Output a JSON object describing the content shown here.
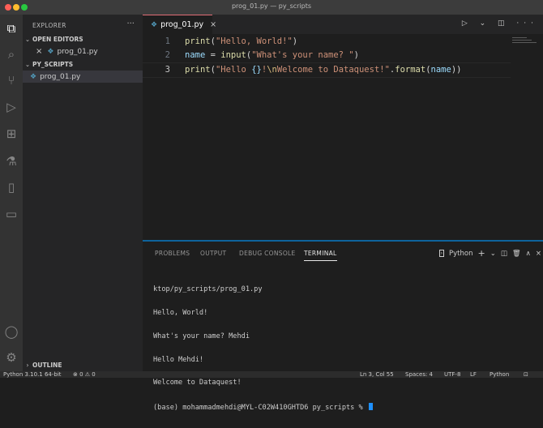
{
  "window": {
    "title": "prog_01.py — py_scripts"
  },
  "traffic_lights": [
    "#ff5f57",
    "#febc2e",
    "#28c840"
  ],
  "activity_bar": {
    "items": [
      "explorer-icon",
      "search-icon",
      "source-control-icon",
      "run-debug-icon",
      "extensions-icon",
      "flask-icon",
      "book-icon",
      "remote-explorer-icon",
      "account-icon",
      "gear-icon"
    ]
  },
  "sidebar": {
    "title": "EXPLORER",
    "more": "···",
    "open_editors": {
      "label": "OPEN EDITORS",
      "close": "×",
      "file": "prog_01.py"
    },
    "folder": {
      "label": "PY_SCRIPTS",
      "file": "prog_01.py"
    },
    "outline": "OUTLINE"
  },
  "tab": {
    "label": "prog_01.py",
    "close": "×"
  },
  "tab_actions": "▷ ⌄ ◫ ···",
  "editor": {
    "lines": [
      {
        "num": "1",
        "tokens": [
          {
            "t": "print",
            "c": "fn"
          },
          {
            "t": "(",
            "c": "op"
          },
          {
            "t": "\"Hello, World!\"",
            "c": "str"
          },
          {
            "t": ")",
            "c": "op"
          }
        ]
      },
      {
        "num": "2",
        "tokens": [
          {
            "t": "name",
            "c": "var"
          },
          {
            "t": " = ",
            "c": "op"
          },
          {
            "t": "input",
            "c": "fn"
          },
          {
            "t": "(",
            "c": "op"
          },
          {
            "t": "\"What's your name? \"",
            "c": "str"
          },
          {
            "t": ")",
            "c": "op"
          }
        ]
      },
      {
        "num": "3",
        "tokens": [
          {
            "t": "print",
            "c": "fn"
          },
          {
            "t": "(",
            "c": "op"
          },
          {
            "t": "\"Hello ",
            "c": "str"
          },
          {
            "t": "{}",
            "c": "var"
          },
          {
            "t": "!",
            "c": "str"
          },
          {
            "t": "\\n",
            "c": "esc"
          },
          {
            "t": "Welcome to Dataquest!\"",
            "c": "str"
          },
          {
            "t": ".",
            "c": "op"
          },
          {
            "t": "format",
            "c": "fn"
          },
          {
            "t": "(",
            "c": "op"
          },
          {
            "t": "name",
            "c": "var"
          },
          {
            "t": "))",
            "c": "op"
          }
        ]
      }
    ]
  },
  "panel": {
    "tabs": [
      "PROBLEMS",
      "OUTPUT",
      "DEBUG CONSOLE",
      "TERMINAL"
    ],
    "active_tab": "TERMINAL",
    "shell": "Python",
    "actions": [
      "+",
      "⌄",
      "◫",
      "🗑",
      "∧",
      "×"
    ],
    "terminal_lines": [
      "ktop/py_scripts/prog_01.py",
      "Hello, World!",
      "What's your name? Mehdi",
      "Hello Mehdi!",
      "Welcome to Dataquest!",
      "(base) mohammadmehdi@MYL-C02W410GHTD6 py_scripts % "
    ]
  },
  "statusbar": {
    "left": [
      "Python 3.10.1 64-bit",
      "⊗ 0 ⚠ 0"
    ],
    "right": [
      "Ln 3, Col 55",
      "Spaces: 4",
      "UTF-8",
      "LF",
      "Python",
      "⊡"
    ]
  }
}
